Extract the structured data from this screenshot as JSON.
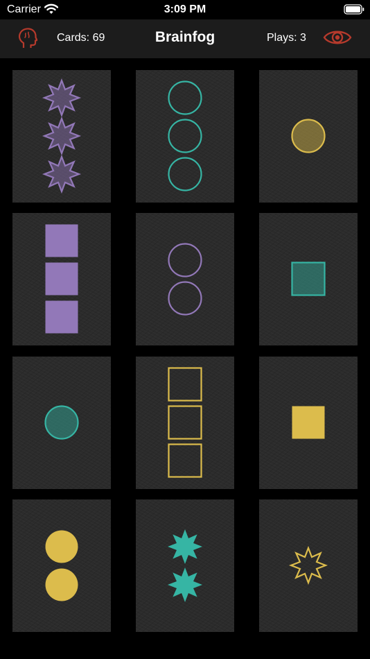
{
  "status_bar": {
    "carrier": "Carrier",
    "time": "3:09 PM"
  },
  "nav": {
    "cards_label": "Cards: 69",
    "title": "Brainfog",
    "plays_label": "Plays: 3",
    "accent_color": "#b63a2c"
  },
  "colors": {
    "purple": "#9278b8",
    "teal": "#36b5a4",
    "yellow": "#dcbc4c"
  },
  "cards": [
    {
      "count": 3,
      "shape": "star",
      "color": "purple",
      "fill": "shaded"
    },
    {
      "count": 3,
      "shape": "circle",
      "color": "teal",
      "fill": "outline"
    },
    {
      "count": 1,
      "shape": "circle",
      "color": "yellow",
      "fill": "shaded"
    },
    {
      "count": 3,
      "shape": "square",
      "color": "purple",
      "fill": "solid"
    },
    {
      "count": 2,
      "shape": "circle",
      "color": "purple",
      "fill": "outline"
    },
    {
      "count": 1,
      "shape": "square",
      "color": "teal",
      "fill": "shaded"
    },
    {
      "count": 1,
      "shape": "circle",
      "color": "teal",
      "fill": "shaded"
    },
    {
      "count": 3,
      "shape": "square",
      "color": "yellow",
      "fill": "outline"
    },
    {
      "count": 1,
      "shape": "square",
      "color": "yellow",
      "fill": "solid"
    },
    {
      "count": 2,
      "shape": "circle",
      "color": "yellow",
      "fill": "solid"
    },
    {
      "count": 2,
      "shape": "star",
      "color": "teal",
      "fill": "solid"
    },
    {
      "count": 1,
      "shape": "star",
      "color": "yellow",
      "fill": "outline"
    }
  ]
}
